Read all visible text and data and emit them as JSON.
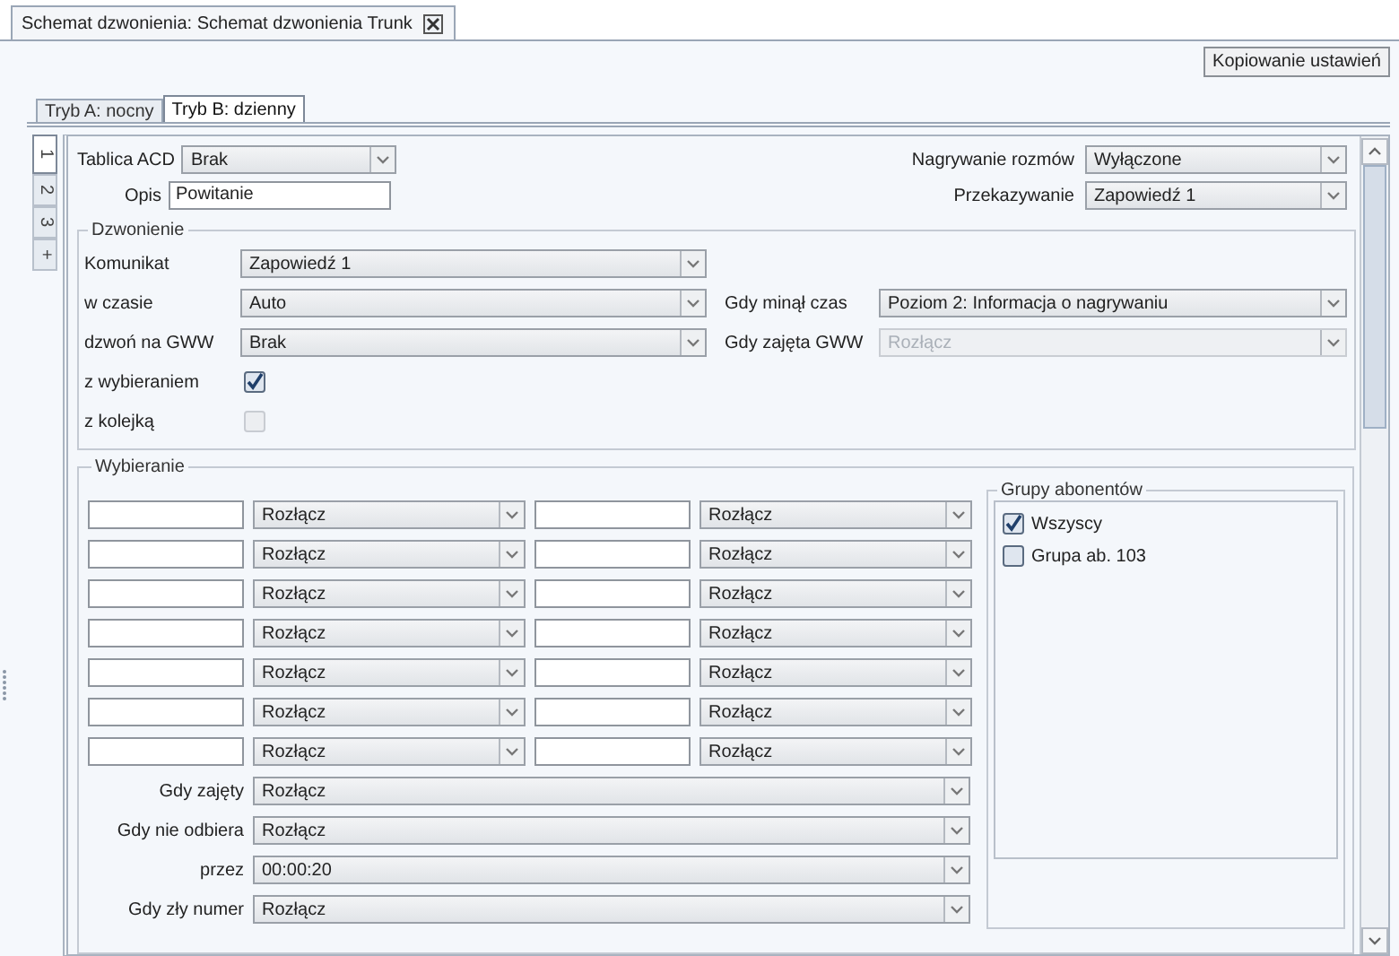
{
  "document_tab": {
    "title": "Schemat dzwonienia: Schemat dzwonienia Trunk"
  },
  "copy_button": "Kopiowanie ustawień",
  "mode_tabs": [
    {
      "label": "Tryb A: nocny",
      "selected": false
    },
    {
      "label": "Tryb B: dzienny",
      "selected": true
    }
  ],
  "side_tabs": [
    {
      "label": "1",
      "selected": true
    },
    {
      "label": "2",
      "selected": false
    },
    {
      "label": "3",
      "selected": false
    },
    {
      "label": "+",
      "selected": false
    }
  ],
  "header_fields": [
    {
      "left": {
        "label": "Tablica ACD",
        "kind": "select",
        "value": "Brak"
      },
      "right": {
        "label": "Nagrywanie rozmów",
        "kind": "select",
        "value": "Wyłączone"
      }
    },
    {
      "left": {
        "label": "Opis",
        "kind": "text",
        "value": "Powitanie"
      },
      "right": {
        "label": "Przekazywanie",
        "kind": "select",
        "value": "Zapowiedź 1"
      }
    }
  ],
  "ringing": {
    "title": "Dzwonienie",
    "rows": [
      {
        "left": {
          "label": "Komunikat",
          "kind": "select",
          "value": "Zapowiedź 1",
          "disabled": false
        }
      },
      {
        "left": {
          "label": "w czasie",
          "kind": "select",
          "value": "Auto",
          "disabled": false
        },
        "right": {
          "label": "Gdy minął czas",
          "value": "Poziom 2: Informacja o nagrywaniu",
          "disabled": false
        }
      },
      {
        "left": {
          "label": "dzwoń na GWW",
          "kind": "select",
          "value": "Brak",
          "disabled": false
        },
        "right": {
          "label": "Gdy zajęta GWW",
          "value": "Rozłącz",
          "disabled": true
        }
      },
      {
        "left": {
          "label": "z wybieraniem",
          "kind": "checkbox",
          "checked": true,
          "disabled": false
        }
      },
      {
        "left": {
          "label": "z kolejką",
          "kind": "checkbox",
          "checked": false,
          "disabled": true
        }
      }
    ]
  },
  "dialing": {
    "title": "Wybieranie",
    "steps": [
      {
        "left_action": "Rozłącz",
        "right_action": "Rozłącz"
      },
      {
        "left_action": "Rozłącz",
        "right_action": "Rozłącz"
      },
      {
        "left_action": "Rozłącz",
        "right_action": "Rozłącz"
      },
      {
        "left_action": "Rozłącz",
        "right_action": "Rozłącz"
      },
      {
        "left_action": "Rozłącz",
        "right_action": "Rozłącz"
      },
      {
        "left_action": "Rozłącz",
        "right_action": "Rozłącz"
      },
      {
        "left_action": "Rozłącz",
        "right_action": "Rozłącz"
      }
    ],
    "options": [
      {
        "label": "Gdy zajęty",
        "value": "Rozłącz"
      },
      {
        "label": "Gdy nie odbiera",
        "value": "Rozłącz"
      },
      {
        "label": "przez",
        "value": "00:00:20"
      },
      {
        "label": "Gdy zły numer",
        "value": "Rozłącz"
      }
    ],
    "groups": {
      "title": "Grupy abonentów",
      "items": [
        {
          "label": "Wszyscy",
          "checked": true
        },
        {
          "label": "Grupa ab. 103",
          "checked": false
        }
      ]
    }
  }
}
